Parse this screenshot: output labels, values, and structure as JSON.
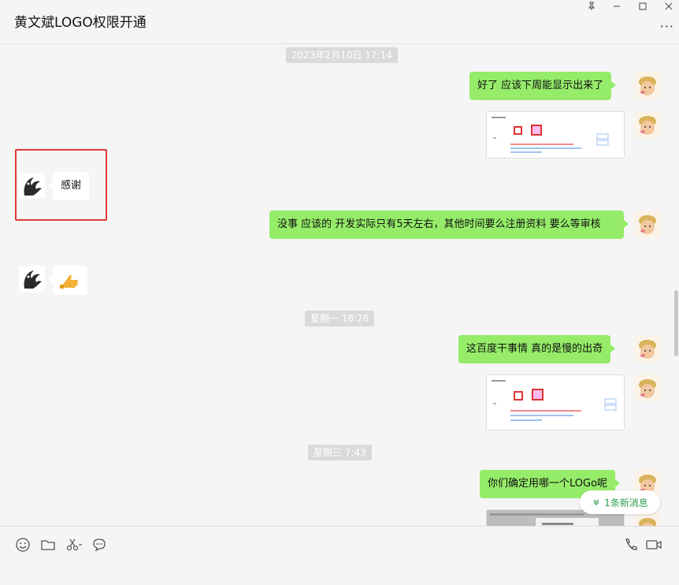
{
  "chat": {
    "title": "黄文斌LOGO权限开通"
  },
  "window": {
    "pin_icon": "pin-icon",
    "minimize_icon": "minimize-icon",
    "maximize_icon": "maximize-icon",
    "close_icon": "close-icon",
    "more_icon": "more-icon"
  },
  "timestamps": [
    "2023年2月10日 17:14",
    "星期一 18:26",
    "星期三 7:43"
  ],
  "messages": {
    "m1": "好了 应该下周能显示出来了",
    "m3": "感谢",
    "m4": "没事 应该的  开发实际只有5天左右，其他时间要么注册资料 要么等审核",
    "m5_icon": "thumbs-up-emoji",
    "m6": "这百度干事情  真的是慢的出奇",
    "m8": "你们确定用哪一个LOGo呢"
  },
  "new_messages": {
    "label": "1条新消息"
  },
  "colors": {
    "bubble_self": "#95ec69",
    "bubble_other": "#ffffff",
    "highlight": "#e53935",
    "accent": "#2e9e4f"
  },
  "toolbar": {
    "icons": [
      "emoji-icon",
      "folder-icon",
      "scissors-icon",
      "chat-history-icon",
      "phone-icon",
      "video-icon"
    ]
  }
}
